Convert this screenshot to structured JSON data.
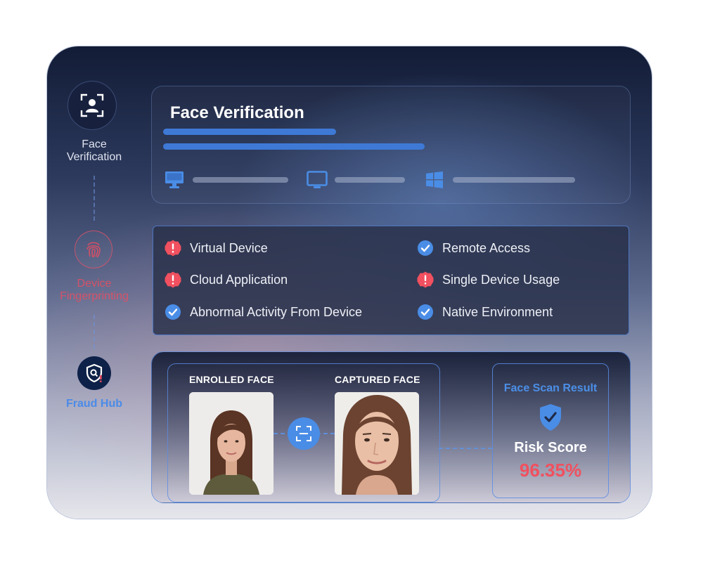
{
  "steps": [
    {
      "label": "Face\nVerification",
      "icon": "face-scan-icon"
    },
    {
      "label": "Device\nFingerprinting",
      "icon": "fingerprint-icon"
    },
    {
      "label": "Fraud Hub",
      "icon": "shield-search-icon"
    }
  ],
  "face_card": {
    "title": "Face Verification",
    "platforms": [
      "desktop-icon",
      "tablet-icon",
      "windows-icon"
    ]
  },
  "device_checks": [
    {
      "label": "Virtual Device",
      "status": "alert"
    },
    {
      "label": "Remote Access",
      "status": "ok"
    },
    {
      "label": "Cloud Application",
      "status": "alert"
    },
    {
      "label": "Single Device Usage",
      "status": "alert"
    },
    {
      "label": "Abnormal Activity From Device",
      "status": "ok"
    },
    {
      "label": "Native Environment",
      "status": "ok"
    }
  ],
  "fraud": {
    "enrolled_label": "ENROLLED FACE",
    "captured_label": "CAPTURED FACE",
    "result_title": "Face Scan Result",
    "risk_label": "Risk Score",
    "risk_value": "96.35%"
  },
  "colors": {
    "accent_blue": "#3e79d6",
    "alert_red": "#f0505f",
    "ok_blue": "#4a8de6"
  }
}
